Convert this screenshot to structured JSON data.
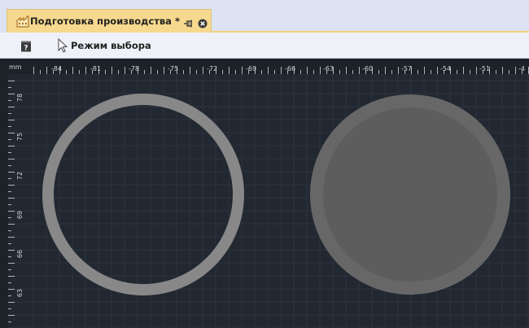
{
  "tab": {
    "title": "Подготовка производства",
    "modified_marker": "*",
    "icon": "factory-icon",
    "pin_icon": "pin-icon",
    "close_icon": "close-circle-icon"
  },
  "toolbar": {
    "help_icon": "help-icon",
    "mode_icon": "cursor-arrow-icon",
    "mode_label": "Режим выбора"
  },
  "ruler": {
    "unit": "mm",
    "x_labels": [
      "-84",
      "-81",
      "-78",
      "-75",
      "-72",
      "-69",
      "-66",
      "-63",
      "-60",
      "-57",
      "-54",
      "-51",
      "-4"
    ],
    "y_labels": [
      "78",
      "75",
      "72",
      "69",
      "66",
      "63"
    ]
  },
  "colors": {
    "canvas_bg": "#222831",
    "grid": "#2c333d",
    "ring": "#888888",
    "disk": "#5d5d5d",
    "disk_edge": "#676767",
    "tab_bg": "#f6d98e",
    "tabbar_bg": "#dde3f3",
    "toolbar_bg": "#eef1f8"
  }
}
